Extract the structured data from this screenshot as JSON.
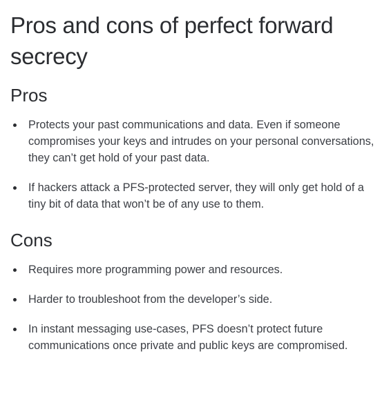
{
  "article": {
    "title": "Pros and cons of perfect forward secrecy",
    "pros": {
      "heading": "Pros",
      "items": [
        "Protects your past communications and data. Even if someone compromises your keys and intrudes on your personal conversations, they can’t get hold of your past data.",
        "If hackers attack a PFS-protected server, they will only get hold of a tiny bit of data that won’t be of any use to them."
      ]
    },
    "cons": {
      "heading": "Cons",
      "items": [
        "Requires more programming power and resources.",
        "Harder to troubleshoot from the developer’s side.",
        "In instant messaging use-cases, PFS doesn’t protect future communications once private and public keys are compromised."
      ]
    }
  }
}
